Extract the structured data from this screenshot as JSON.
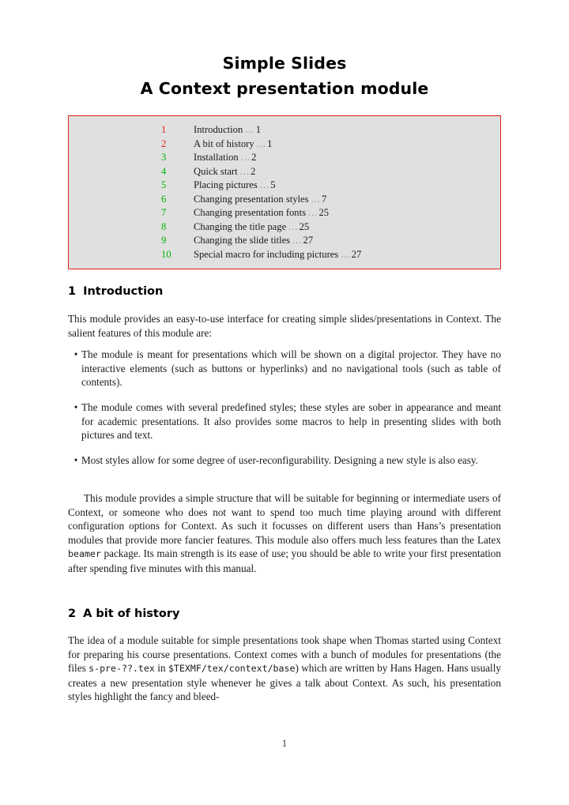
{
  "document": {
    "title_line_1": "Simple Slides",
    "title_line_2": "A Context presentation module",
    "folio": "1"
  },
  "colors": {
    "toc_border": "#e02020",
    "toc_background": "#e0e0e0",
    "number_red": "#e02020",
    "number_green": "#00b400",
    "text": "#1a1a1a",
    "dots": "#8d8d8d"
  },
  "toc": {
    "dots": "...",
    "entries": [
      {
        "number": "1",
        "title": "Introduction",
        "page": "1",
        "color": "red"
      },
      {
        "number": "2",
        "title": "A bit of history",
        "page": "1",
        "color": "red"
      },
      {
        "number": "3",
        "title": "Installation",
        "page": "2",
        "color": "green"
      },
      {
        "number": "4",
        "title": "Quick start",
        "page": "2",
        "color": "green"
      },
      {
        "number": "5",
        "title": "Placing pictures",
        "page": "5",
        "color": "green"
      },
      {
        "number": "6",
        "title": "Changing presentation styles",
        "page": "7",
        "color": "green"
      },
      {
        "number": "7",
        "title": "Changing presentation fonts",
        "page": "25",
        "color": "green"
      },
      {
        "number": "8",
        "title": "Changing the title page",
        "page": "25",
        "color": "green"
      },
      {
        "number": "9",
        "title": "Changing the slide titles",
        "page": "27",
        "color": "green"
      },
      {
        "number": "10",
        "title": "Special macro for including pictures",
        "page": "27",
        "color": "green"
      }
    ]
  },
  "sections": {
    "introduction": {
      "number": "1",
      "heading": "Introduction",
      "intro_paragraph": "This module provides an easy-to-use interface for creating simple slides/presentations in Context. The salient features of this module are:",
      "bullets": [
        {
          "marker": "•",
          "text": "The module is meant for presentations which will be shown on a digital projector. They have no interactive elements (such as buttons or hyperlinks) and no navigational tools (such as table of contents)."
        },
        {
          "marker": "•",
          "text": "The module comes with several predefined styles; these styles are sober in appear­ance and meant for academic presentations. It also provides some macros to help in presenting slides with both pictures and text."
        },
        {
          "marker": "•",
          "text": "Most styles allow for some degree of user-reconfigurability. Designing a new style is also easy."
        }
      ],
      "closing_paragraph_part_1": "This module provides a simple structure that will be suitable for beginning or interme­diate users of Context, or someone who does not want to spend too much time playing around with different configuration options for Context. As such it focusses on different users than Hans’s presentation modules that provide more fancier features. This module also offers much less features than the Latex ",
      "closing_paragraph_mono": "beamer",
      "closing_paragraph_part_2": " package. Its main strength is its ease of use; you should be able to write your first presentation after spending five minutes with this manual."
    },
    "history": {
      "number": "2",
      "heading": "A bit of history",
      "paragraph_part_1": "The idea of a module suitable for simple presentations took shape when Thomas started using Context for preparing his course presentations. Context comes with a bunch of modules for presentations (the files ",
      "paragraph_mono_1": "s-pre-??.tex",
      "paragraph_part_2": " in ",
      "paragraph_mono_2": "$TEXMF/tex/context/base",
      "paragraph_part_3": ") which are written by Hans Hagen. Hans usually creates a new presentation style whenever he gives a talk about Context. As such, his presentation styles highlight the fancy and bleed-"
    }
  }
}
